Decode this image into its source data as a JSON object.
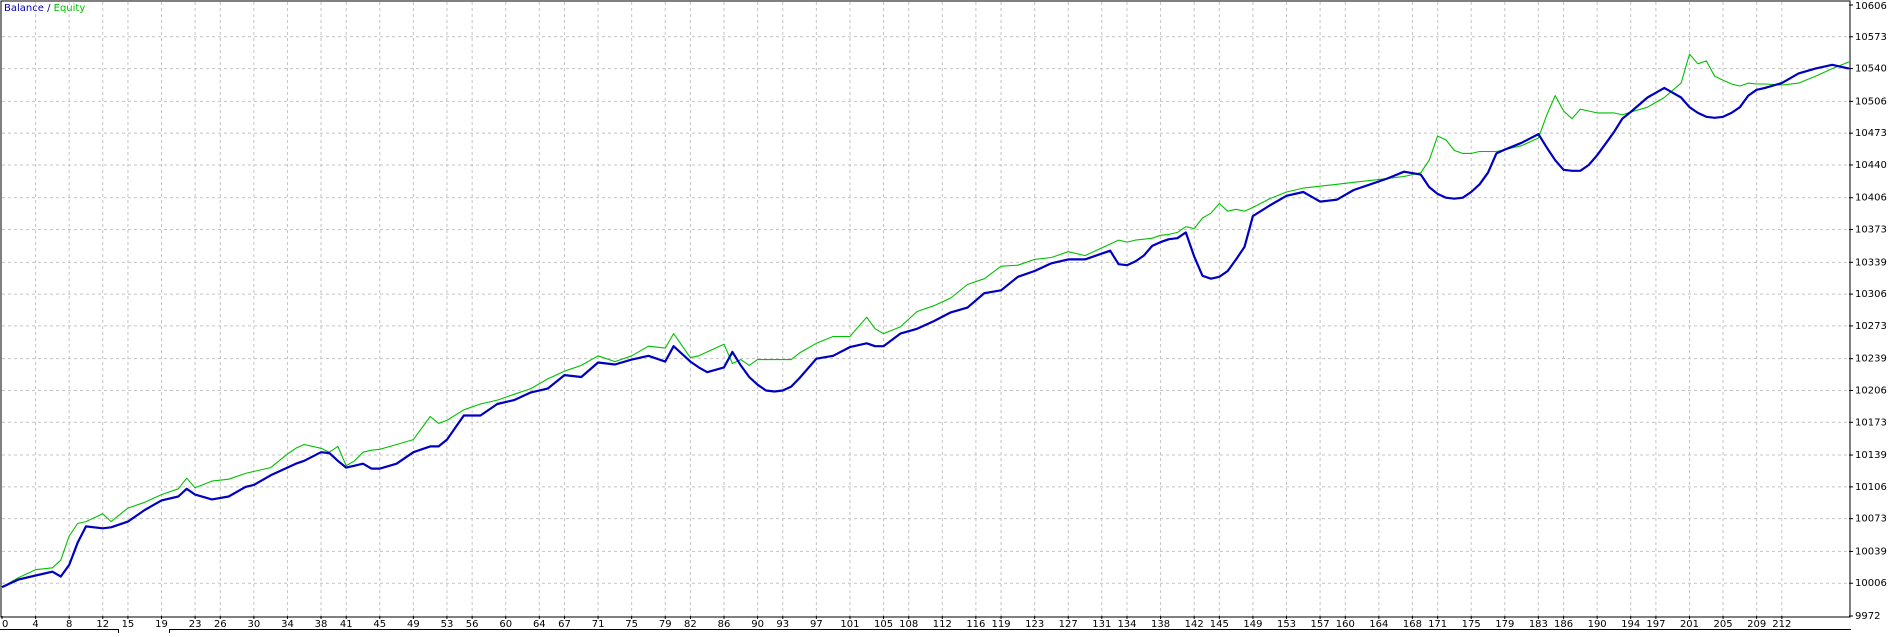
{
  "legend": {
    "balance_label": "Balance",
    "separator": " / ",
    "equity_label": "Equity",
    "balance_color": "#0000C0",
    "equity_color": "#00C000"
  },
  "chart_data": {
    "type": "line",
    "x_ticks": [
      "0",
      "4",
      "8",
      "12",
      "15",
      "19",
      "23",
      "26",
      "30",
      "34",
      "38",
      "41",
      "45",
      "49",
      "53",
      "56",
      "60",
      "64",
      "67",
      "71",
      "75",
      "79",
      "82",
      "86",
      "90",
      "93",
      "97",
      "101",
      "105",
      "108",
      "112",
      "116",
      "119",
      "123",
      "127",
      "131",
      "134",
      "138",
      "142",
      "145",
      "149",
      "153",
      "157",
      "160",
      "164",
      "168",
      "171",
      "175",
      "179",
      "183",
      "186",
      "190",
      "194",
      "197",
      "201",
      "205",
      "209",
      "212"
    ],
    "y_ticks": [
      "10606",
      "10573",
      "10540",
      "10506",
      "10473",
      "10440",
      "10406",
      "10373",
      "10339",
      "10306",
      "10273",
      "10239",
      "10206",
      "10173",
      "10139",
      "10106",
      "10073",
      "10039",
      "10006",
      "9972"
    ],
    "xlim": [
      0,
      220
    ],
    "ylim": [
      9972,
      10606
    ],
    "grid": true,
    "legend_position": "top-left",
    "series": [
      {
        "name": "Balance",
        "color": "#0000C0",
        "x": [
          0,
          2,
          4,
          6,
          7,
          8,
          9,
          10,
          12,
          13,
          15,
          17,
          19,
          21,
          22,
          23,
          25,
          27,
          29,
          30,
          32,
          34,
          35,
          36,
          38,
          39,
          40,
          41,
          42,
          43,
          44,
          45,
          47,
          49,
          51,
          52,
          53,
          55,
          57,
          59,
          61,
          63,
          65,
          67,
          69,
          71,
          73,
          75,
          77,
          79,
          80,
          82,
          83,
          84,
          86,
          87,
          88,
          89,
          90,
          91,
          92,
          93,
          94,
          95,
          97,
          99,
          101,
          103,
          104,
          105,
          107,
          109,
          111,
          113,
          115,
          117,
          119,
          121,
          123,
          125,
          127,
          129,
          131,
          132,
          133,
          134,
          135,
          136,
          137,
          138,
          139,
          140,
          141,
          142,
          143,
          144,
          145,
          146,
          147,
          148,
          149,
          151,
          153,
          155,
          157,
          159,
          161,
          163,
          165,
          167,
          169,
          170,
          171,
          172,
          173,
          174,
          175,
          176,
          177,
          178,
          179,
          181,
          183,
          184,
          185,
          186,
          187,
          188,
          189,
          190,
          191,
          192,
          193,
          194,
          196,
          198,
          200,
          201,
          202,
          203,
          204,
          205,
          206,
          207,
          208,
          209,
          210,
          212,
          214,
          216,
          218,
          220
        ],
        "y": [
          10002,
          10010,
          10014,
          10018,
          10013,
          10025,
          10048,
          10065,
          10063,
          10064,
          10070,
          10082,
          10092,
          10096,
          10104,
          10098,
          10093,
          10096,
          10106,
          10108,
          10118,
          10126,
          10130,
          10133,
          10142,
          10141,
          10133,
          10126,
          10128,
          10130,
          10125,
          10125,
          10130,
          10142,
          10148,
          10148,
          10155,
          10180,
          10180,
          10192,
          10196,
          10204,
          10208,
          10222,
          10220,
          10235,
          10233,
          10238,
          10242,
          10236,
          10252,
          10236,
          10230,
          10225,
          10230,
          10246,
          10232,
          10220,
          10212,
          10206,
          10205,
          10206,
          10210,
          10219,
          10239,
          10242,
          10251,
          10255,
          10252,
          10252,
          10265,
          10270,
          10278,
          10287,
          10292,
          10307,
          10310,
          10324,
          10330,
          10338,
          10342,
          10342,
          10348,
          10351,
          10337,
          10336,
          10340,
          10346,
          10356,
          10360,
          10363,
          10364,
          10370,
          10345,
          10325,
          10322,
          10324,
          10330,
          10342,
          10355,
          10387,
          10398,
          10408,
          10412,
          10402,
          10404,
          10414,
          10420,
          10426,
          10433,
          10430,
          10417,
          10410,
          10406,
          10405,
          10406,
          10412,
          10420,
          10432,
          10452,
          10456,
          10463,
          10472,
          10458,
          10445,
          10435,
          10434,
          10434,
          10440,
          10450,
          10462,
          10474,
          10488,
          10495,
          10510,
          10520,
          10510,
          10500,
          10494,
          10490,
          10489,
          10490,
          10494,
          10500,
          10512,
          10518,
          10520,
          10525,
          10535,
          10540,
          10544,
          10540
        ]
      },
      {
        "name": "Equity",
        "color": "#00C000",
        "x": [
          0,
          2,
          4,
          6,
          7,
          8,
          9,
          10,
          12,
          13,
          15,
          17,
          19,
          21,
          22,
          23,
          25,
          27,
          29,
          30,
          32,
          34,
          35,
          36,
          38,
          39,
          40,
          41,
          42,
          43,
          44,
          45,
          47,
          49,
          51,
          52,
          53,
          55,
          57,
          59,
          61,
          63,
          65,
          67,
          69,
          71,
          73,
          75,
          77,
          79,
          80,
          82,
          83,
          84,
          86,
          87,
          88,
          89,
          90,
          91,
          92,
          93,
          94,
          95,
          97,
          99,
          101,
          103,
          104,
          105,
          107,
          109,
          111,
          113,
          115,
          117,
          119,
          121,
          123,
          125,
          127,
          129,
          131,
          132,
          133,
          134,
          135,
          136,
          137,
          138,
          139,
          140,
          141,
          142,
          143,
          144,
          145,
          146,
          147,
          148,
          149,
          151,
          153,
          155,
          157,
          159,
          161,
          163,
          165,
          167,
          169,
          170,
          171,
          172,
          173,
          174,
          175,
          176,
          177,
          178,
          179,
          181,
          183,
          184,
          185,
          186,
          187,
          188,
          189,
          190,
          191,
          192,
          193,
          194,
          196,
          198,
          200,
          201,
          202,
          203,
          204,
          205,
          206,
          207,
          208,
          209,
          210,
          212,
          214,
          216,
          218,
          220
        ],
        "y": [
          10002,
          10012,
          10020,
          10022,
          10030,
          10055,
          10068,
          10070,
          10078,
          10070,
          10084,
          10090,
          10098,
          10104,
          10115,
          10105,
          10112,
          10114,
          10120,
          10122,
          10126,
          10140,
          10146,
          10150,
          10146,
          10142,
          10148,
          10128,
          10133,
          10142,
          10144,
          10145,
          10150,
          10155,
          10179,
          10172,
          10175,
          10186,
          10192,
          10196,
          10202,
          10208,
          10218,
          10226,
          10232,
          10242,
          10236,
          10242,
          10252,
          10250,
          10265,
          10240,
          10242,
          10246,
          10254,
          10234,
          10238,
          10232,
          10238,
          10238,
          10238,
          10238,
          10238,
          10245,
          10255,
          10262,
          10262,
          10282,
          10270,
          10265,
          10272,
          10288,
          10294,
          10302,
          10316,
          10322,
          10335,
          10336,
          10342,
          10344,
          10350,
          10346,
          10354,
          10358,
          10362,
          10360,
          10362,
          10363,
          10364,
          10367,
          10368,
          10370,
          10376,
          10374,
          10385,
          10390,
          10400,
          10392,
          10394,
          10392,
          10396,
          10405,
          10412,
          10416,
          10418,
          10420,
          10422,
          10424,
          10426,
          10428,
          10432,
          10445,
          10470,
          10466,
          10455,
          10452,
          10452,
          10454,
          10454,
          10454,
          10456,
          10460,
          10468,
          10492,
          10512,
          10496,
          10488,
          10498,
          10496,
          10494,
          10494,
          10494,
          10492,
          10495,
          10500,
          10510,
          10525,
          10555,
          10545,
          10548,
          10532,
          10528,
          10524,
          10522,
          10525,
          10524,
          10524,
          10523,
          10525,
          10532,
          10540,
          10547
        ]
      }
    ]
  }
}
